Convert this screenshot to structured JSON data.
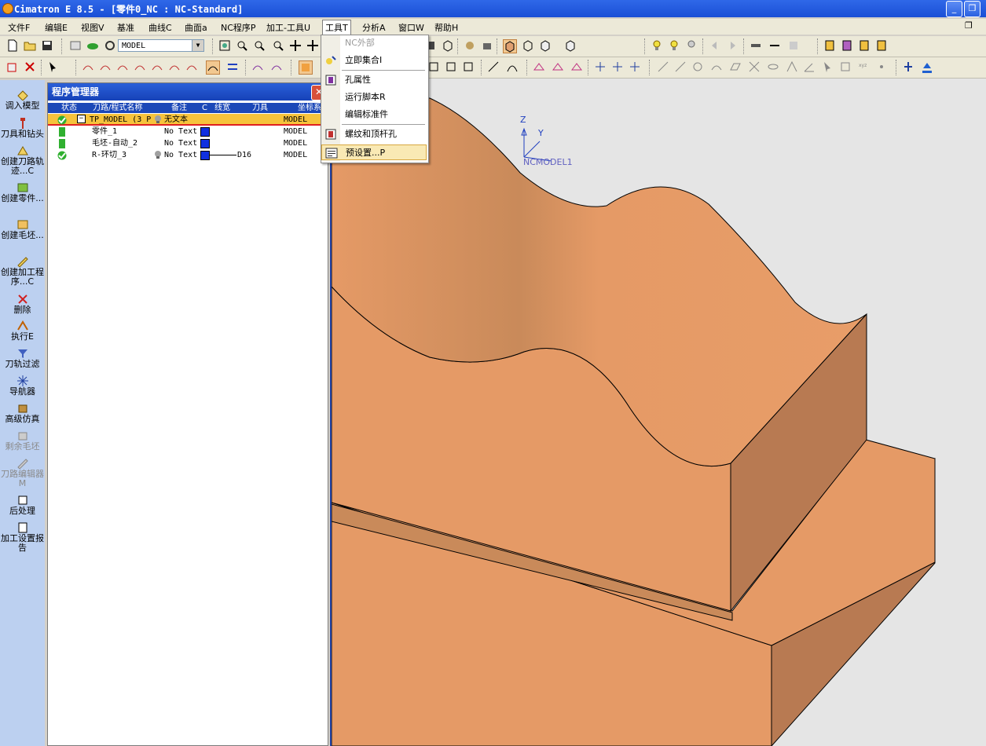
{
  "window": {
    "title": "Cimatron E 8.5 - [零件0_NC : NC-Standard]"
  },
  "menu": {
    "items": [
      "文件F",
      "编辑E",
      "视图V",
      "基准",
      "曲线C",
      "曲面a",
      "NC程序P",
      "加工-工具U",
      "工具T",
      "分析A",
      "窗口W",
      "帮助H"
    ],
    "active_index": 8
  },
  "toolbar": {
    "model_select": "MODEL"
  },
  "tools_menu": {
    "items": [
      {
        "label": "NC外部",
        "disabled": true
      },
      {
        "label": "立即集合I"
      },
      {
        "label": "孔属性"
      },
      {
        "label": "运行脚本R"
      },
      {
        "label": "编辑标准件"
      },
      {
        "label": "螺纹和顶杆孔"
      },
      {
        "label": "预设置...P",
        "highlighted": true
      }
    ]
  },
  "sidebar": {
    "items": [
      {
        "label": "调入模型"
      },
      {
        "label": "刀具和钻头"
      },
      {
        "label": "创建刀路轨迹...C"
      },
      {
        "label": "创建零件..."
      },
      {
        "label": "创建毛坯..."
      },
      {
        "label": "创建加工程序...C"
      },
      {
        "label": "删除"
      },
      {
        "label": "执行E"
      },
      {
        "label": "刀轨过滤"
      },
      {
        "label": "导航器"
      },
      {
        "label": "高级仿真"
      },
      {
        "label": "剩余毛坯",
        "disabled": true
      },
      {
        "label": "刀路编辑器M",
        "disabled": true
      },
      {
        "label": "后处理"
      },
      {
        "label": "加工设置报告"
      }
    ]
  },
  "program_manager": {
    "title": "程序管理器",
    "columns": [
      "状态",
      "刀路/程式名称",
      "备注",
      "C",
      "线宽",
      "刀具",
      "坐标系"
    ],
    "rows": [
      {
        "name": "TP_MODEL (3 P",
        "note": "无文本",
        "tool": "",
        "coord": "MODEL",
        "selected": true
      },
      {
        "name": "零件_1",
        "note": "No Text",
        "tool": "",
        "coord": "MODEL"
      },
      {
        "name": "毛坯-自动_2",
        "note": "No Text",
        "tool": "",
        "coord": "MODEL"
      },
      {
        "name": "R-环切_3",
        "note": "No Text",
        "tool": "D16",
        "coord": "MODEL"
      }
    ]
  },
  "viewport": {
    "axis_z": "Z",
    "axis_y": "Y",
    "axis_label": "NCMODEL1",
    "model_color": "#e59a66"
  }
}
